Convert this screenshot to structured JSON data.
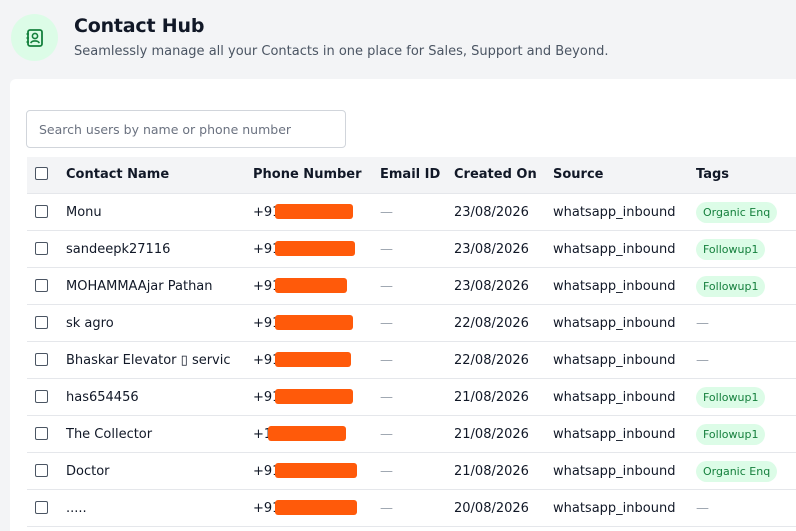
{
  "header": {
    "title": "Contact Hub",
    "subtitle": "Seamlessly manage all your Contacts in one place for Sales, Support and Beyond."
  },
  "search": {
    "placeholder": "Search users by name or phone number",
    "value": ""
  },
  "table": {
    "columns": [
      "Contact Name",
      "Phone Number",
      "Email ID",
      "Created On",
      "Source",
      "Tags"
    ],
    "rows": [
      {
        "name": "Monu",
        "phone_prefix": "+91",
        "email": "—",
        "created": "23/08/2026",
        "source": "whatsapp_inbound",
        "tag": "Organic Enq"
      },
      {
        "name": "sandeepk27116",
        "phone_prefix": "+91",
        "email": "—",
        "created": "23/08/2026",
        "source": "whatsapp_inbound",
        "tag": "Followup1"
      },
      {
        "name": "MOHAMMAAjar Pathan",
        "phone_prefix": "+91",
        "email": "—",
        "created": "23/08/2026",
        "source": "whatsapp_inbound",
        "tag": "Followup1"
      },
      {
        "name": "sk agro",
        "phone_prefix": "+91",
        "email": "—",
        "created": "22/08/2026",
        "source": "whatsapp_inbound",
        "tag": "—"
      },
      {
        "name": "Bhaskar Elevator ▯ servic",
        "phone_prefix": "+91",
        "email": "—",
        "created": "22/08/2026",
        "source": "whatsapp_inbound",
        "tag": "—"
      },
      {
        "name": "has654456",
        "phone_prefix": "+91",
        "email": "—",
        "created": "21/08/2026",
        "source": "whatsapp_inbound",
        "tag": "Followup1"
      },
      {
        "name": "The Collector",
        "phone_prefix": "+1",
        "email": "—",
        "created": "21/08/2026",
        "source": "whatsapp_inbound",
        "tag": "Followup1"
      },
      {
        "name": "Doctor",
        "phone_prefix": "+91",
        "email": "—",
        "created": "21/08/2026",
        "source": "whatsapp_inbound",
        "tag": "Organic Enq"
      },
      {
        "name": ".....",
        "phone_prefix": "+91",
        "email": "—",
        "created": "20/08/2026",
        "source": "whatsapp_inbound",
        "tag": "—"
      }
    ]
  },
  "colors": {
    "accent": "#15803d",
    "tag_bg": "#dcfce7",
    "redaction": "#ff5a0a"
  }
}
